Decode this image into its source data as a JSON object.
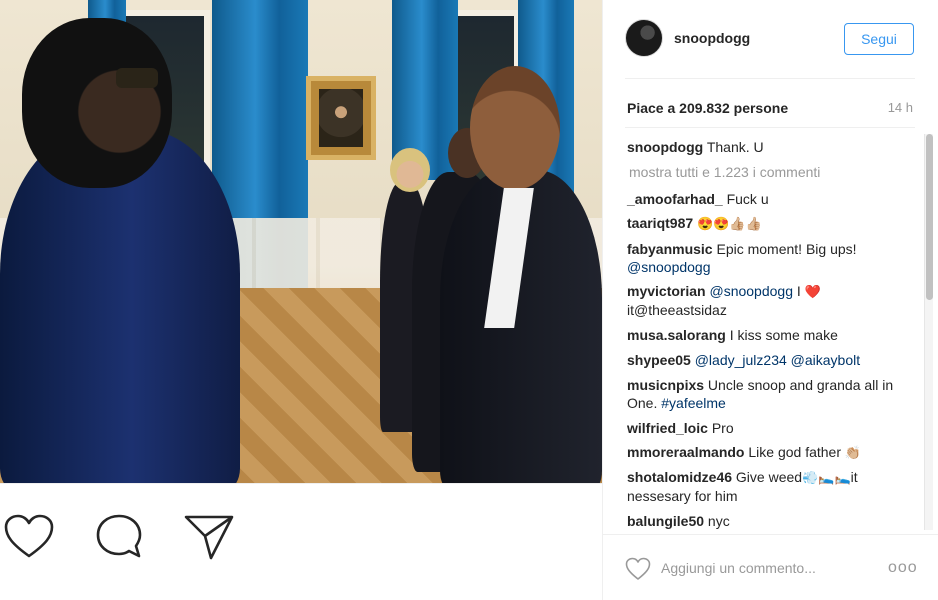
{
  "post": {
    "username": "snoopdogg",
    "follow_label": "Segui",
    "likes_text": "Piace a 209.832 persone",
    "time_ago": "14 h",
    "load_more": "mostra tutti e 1.223 i commenti",
    "comment_placeholder": "Aggiungi un commento...",
    "more_label": "ooo"
  },
  "caption": {
    "user": "snoopdogg",
    "text": "Thank. U"
  },
  "comments": [
    {
      "user": "_amoofarhad_",
      "text": "Fuck u"
    },
    {
      "user": "taariqt987",
      "text": "",
      "emoji": "😍😍👍🏼👍🏼"
    },
    {
      "user": "fabyanmusic",
      "text": "Epic moment! Big ups!",
      "mention": "@snoopdogg"
    },
    {
      "user": "myvictorian",
      "mention": "@snoopdogg",
      "text": "I",
      "emoji": "❤️",
      "text2": "it@theeastsidaz"
    },
    {
      "user": "musa.salorang",
      "text": "I kiss some make"
    },
    {
      "user": "shypee05",
      "mention": "@lady_julz234",
      "mention2": "@aikaybolt"
    },
    {
      "user": "musicnpixs",
      "text": "Uncle snoop and granda all in One.",
      "mention": "#yafeelme"
    },
    {
      "user": "wilfried_loic",
      "text": "Pro"
    },
    {
      "user": "mmoreraalmando",
      "text": "Like god father",
      "emoji": "👏🏼"
    },
    {
      "user": "shotalomidze46",
      "text": "Give weed",
      "emoji": "💨🛌🏼🛌🏼",
      "text2": "it nessesary for him"
    },
    {
      "user": "balungile50",
      "text": "nyc"
    }
  ],
  "icons": {
    "like": "heart-icon",
    "comment": "speech-bubble-icon",
    "share": "paper-plane-icon",
    "more": "ellipsis-icon"
  },
  "colors": {
    "accent": "#3897f0",
    "mention": "#003569",
    "muted": "#999999",
    "text": "#262626"
  }
}
